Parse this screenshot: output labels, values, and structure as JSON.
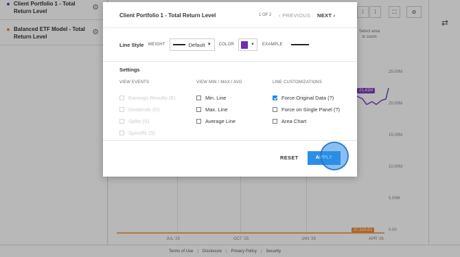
{
  "sidebar": {
    "items": [
      {
        "label": "Client Portfolio 1 - Total Return Level",
        "dot_color": "#7a3fc0"
      },
      {
        "label": "Balanced ETF Model - Total Return Level",
        "dot_color": "#f28c38"
      }
    ]
  },
  "toolbar": {
    "select_area_hint": "Select area to zoom"
  },
  "chart": {
    "y_ticks": [
      "25.00M",
      "20.00M",
      "15.00M",
      "10.00M",
      "5.00M",
      "0.00"
    ],
    "x_ticks": [
      "JUL '25",
      "OCT '25",
      "JAN '26",
      "APR '26"
    ],
    "badge_purple": "21.41M",
    "badge_orange": "37,328.63",
    "colors": {
      "purple": "#7a3fc0",
      "orange": "#f28c38"
    }
  },
  "footer": {
    "links": [
      "Terms of Use",
      "Disclosure",
      "Privacy Policy",
      "Security"
    ]
  },
  "modal": {
    "title": "Client Portfolio 1 - Total Return Level",
    "page_indicator": "1 OF 2",
    "prev_label": "PREVIOUS",
    "next_label": "NEXT",
    "line_style": {
      "title": "Line Style",
      "weight_caption": "WEIGHT",
      "weight_value": "Default",
      "color_caption": "COLOR",
      "color_value": "#6d2fb5",
      "example_caption": "EXAMPLE"
    },
    "settings_title": "Settings",
    "columns": {
      "view_events": {
        "header": "VIEW EVENTS",
        "options": [
          {
            "label": "Earnings Results (E)",
            "checked": false,
            "enabled": false
          },
          {
            "label": "Dividends (D)",
            "checked": false,
            "enabled": false
          },
          {
            "label": "Splits (S)",
            "checked": false,
            "enabled": false
          },
          {
            "label": "Spinoffs (S)",
            "checked": false,
            "enabled": false
          }
        ]
      },
      "view_minmax": {
        "header": "VIEW MIN / MAX / AVG",
        "options": [
          {
            "label": "Min. Line",
            "checked": false,
            "enabled": true
          },
          {
            "label": "Max. Line",
            "checked": false,
            "enabled": true
          },
          {
            "label": "Average Line",
            "checked": false,
            "enabled": true
          }
        ]
      },
      "line_customizations": {
        "header": "LINE CUSTOMIZATIONS",
        "options": [
          {
            "label": "Force Original Data  (?)",
            "checked": true,
            "enabled": true
          },
          {
            "label": "Force on Single Panel  (?)",
            "checked": false,
            "enabled": true
          },
          {
            "label": "Area Chart",
            "checked": false,
            "enabled": true
          }
        ]
      }
    },
    "reset_label": "RESET",
    "apply_label": "APPLY"
  }
}
